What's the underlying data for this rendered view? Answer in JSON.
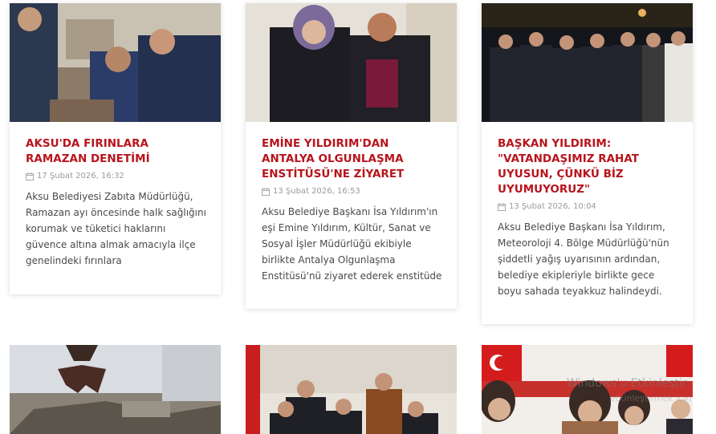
{
  "cards": [
    {
      "title": "AKSU'DA FIRINLARA RAMAZAN DENETİMİ",
      "date": "17 Şubat 2026, 16:32",
      "excerpt": "Aksu Belediyesi Zabıta Müdürlüğü, Ramazan ayı öncesinde halk sağlığını korumak ve tüketici haklarını güvence altına almak amacıyla ilçe genelindeki fırınlara"
    },
    {
      "title": "EMİNE YILDIRIM'DAN ANTALYA OLGUNLAŞMA ENSTİTÜSÜ'NE ZİYARET",
      "date": "13 Şubat 2026, 16:53",
      "excerpt": "Aksu Belediye Başkanı İsa Yıldırım'ın eşi Emine Yıldırım, Kültür, Sanat ve Sosyal İşler Müdürlüğü ekibiyle birlikte Antalya Olgunlaşma Enstitüsü'nü ziyaret ederek enstitüde"
    },
    {
      "title": "BAŞKAN YILDIRIM: \"VATANDAŞIMIZ RAHAT UYUSUN, ÇÜNKÜ BİZ UYUMUYORUZ\"",
      "date": "13 Şubat 2026, 10:04",
      "excerpt": "Aksu Belediye Başkanı İsa Yıldırım, Meteoroloji 4. Bölge Müdürlüğü'nün şiddetli yağış uyarısının ardından, belediye ekipleriyle birlikte gece boyu sahada teyakkuz halindeydi."
    }
  ],
  "watermark": {
    "line1": "Windows'u Etkinleştir",
    "line2": "etkinleştirmek için"
  },
  "colors": {
    "title": "#b8141c",
    "date": "#9a9a9a",
    "excerpt": "#4a4a4a"
  },
  "icons": {
    "date_icon": "calendar-icon"
  }
}
